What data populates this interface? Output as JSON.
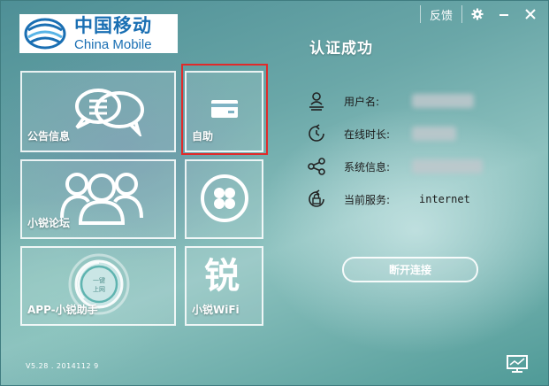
{
  "logo": {
    "cn": "中国移动",
    "en": "China Mobile"
  },
  "titlebar": {
    "feedback": "反馈",
    "settings_icon": "gear-icon",
    "minimize_icon": "minimize-icon",
    "close_icon": "close-icon"
  },
  "tiles": {
    "notice": {
      "label": "公告信息",
      "icon": "speech-bubble-icon"
    },
    "self_service": {
      "label": "自助",
      "icon": "card-icon"
    },
    "forum": {
      "label": "小锐论坛",
      "icon": "people-icon"
    },
    "clover": {
      "icon": "clover-icon"
    },
    "app": {
      "label": "APP-小锐助手",
      "button_text": "一键上网",
      "icon": "power-dial-icon"
    },
    "wifi": {
      "label": "小锐WiFi",
      "glyph": "锐"
    }
  },
  "status": {
    "title": "认证成功",
    "rows": [
      {
        "label": "用户名:",
        "value": "",
        "icon": "user-icon",
        "blurred": true
      },
      {
        "label": "在线时长:",
        "value": "",
        "icon": "clock-icon",
        "blurred": true
      },
      {
        "label": "系统信息:",
        "value": "",
        "icon": "share-icon",
        "blurred": true
      },
      {
        "label": "当前服务:",
        "value": "internet",
        "icon": "lock-icon",
        "blurred": false
      }
    ],
    "disconnect_label": "断开连接"
  },
  "footer": {
    "version": "V5.28 . 2014112 9",
    "monitor_icon": "monitor-icon"
  },
  "colors": {
    "highlight": "#e02a2a",
    "brand": "#1a6fb3"
  }
}
